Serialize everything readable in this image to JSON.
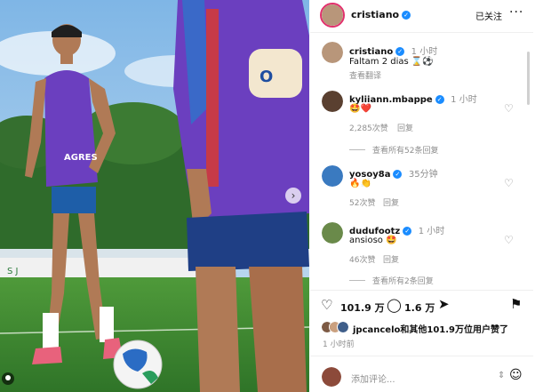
{
  "header": {
    "username": "cristiano",
    "follow_label": "已关注",
    "more_label": "···"
  },
  "caption": {
    "username": "cristiano",
    "time": "1 小时",
    "text": "Faltam 2 dias ⌛⚽",
    "translate_label": "查看翻译"
  },
  "comments": [
    {
      "username": "kyliiann.mbappe",
      "time": "1 小时",
      "text": "🤩❤️",
      "likes": "2,285次赞",
      "reply_label": "回复",
      "view_replies": "查看所有52条回复"
    },
    {
      "username": "yosoy8a",
      "time": "35分钟",
      "text": "🔥👏",
      "likes": "52次赞",
      "reply_label": "回复"
    },
    {
      "username": "dudufootz",
      "time": "1 小时",
      "text": "ansioso 🤩",
      "likes": "46次赞",
      "reply_label": "回复",
      "view_replies": "查看所有2条回复"
    }
  ],
  "actions": {
    "likes_count": "101.9 万",
    "comments_count": "1.6 万"
  },
  "liked_by": "jpcancelo和其他101.9万位用户赞了",
  "post_time": "1 小时前",
  "add_comment": {
    "placeholder": "添加评论..."
  },
  "photo": {
    "shirt_text": "AGRES",
    "sign_text": "S J"
  },
  "colors": {
    "verified": "#1a8cff",
    "heart_red": "#ed4956",
    "jersey_purple": "#6b3fbf"
  }
}
